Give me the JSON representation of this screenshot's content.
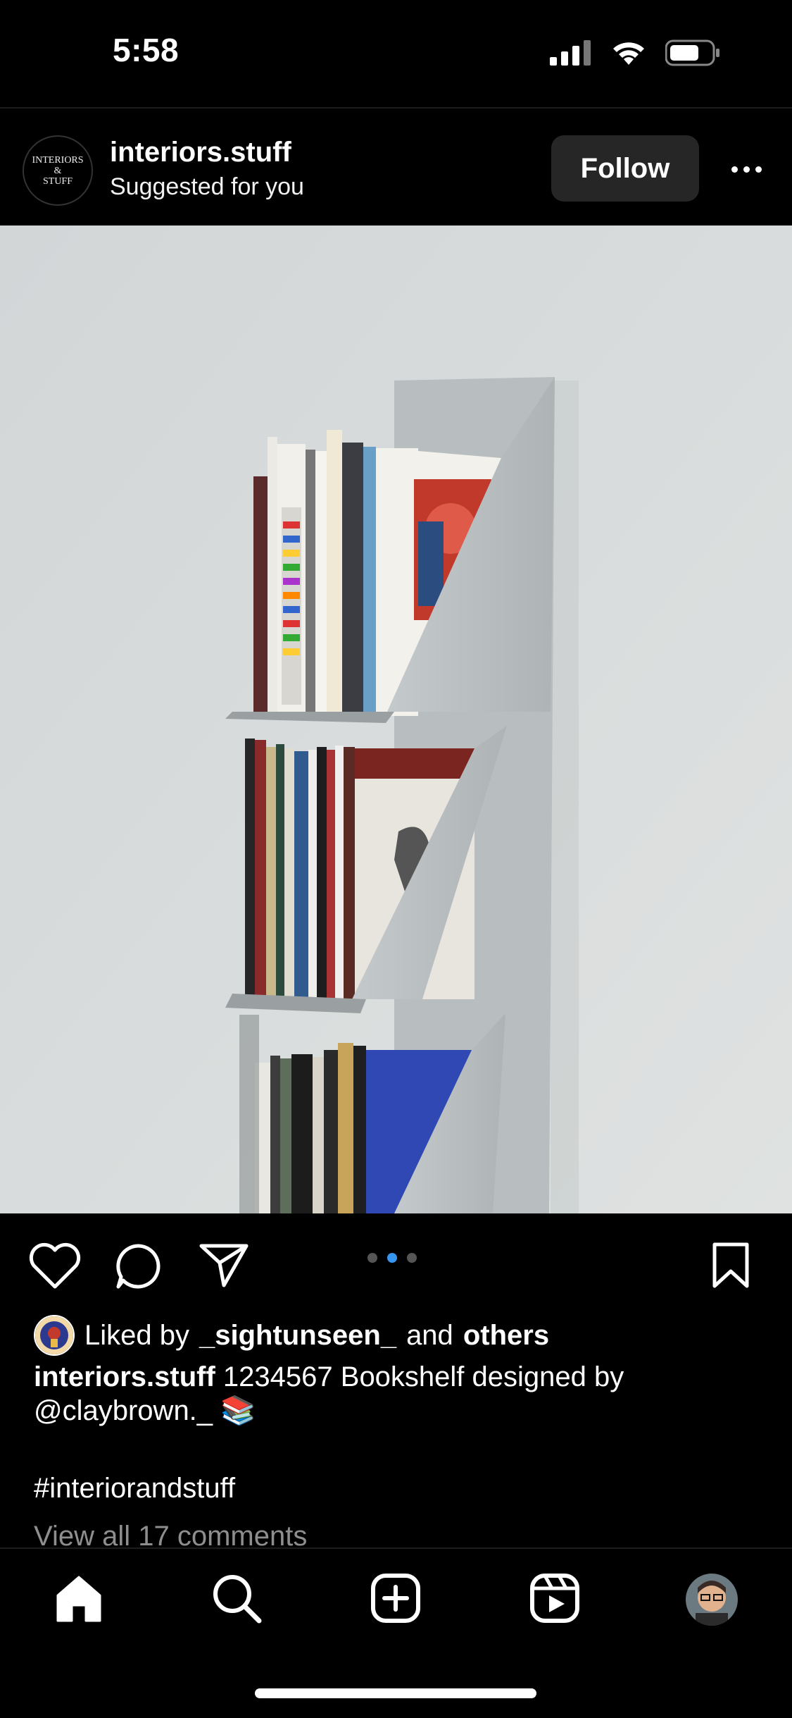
{
  "status_bar": {
    "time": "5:58"
  },
  "post": {
    "username": "interiors.stuff",
    "subtitle": "Suggested for you",
    "follow_label": "Follow",
    "avatar_text": {
      "line1": "INTERIORS",
      "line2": "&",
      "line3": "STUFF"
    },
    "carousel": {
      "count": 3,
      "active_index": 1
    },
    "liked_by_prefix": "Liked by",
    "liked_by_user": "_sightunseen_",
    "liked_by_and": "and",
    "liked_by_others": "others",
    "caption_user": "interiors.stuff",
    "caption_text": "1234567 Bookshelf designed by @claybrown._ 📚",
    "hashtag": "#interiorandstuff",
    "comments_link": "View all 17 comments"
  },
  "tab_bar": {
    "items": [
      "home-icon",
      "search-icon",
      "create-icon",
      "reels-icon",
      "profile-avatar"
    ]
  },
  "colors": {
    "background": "#000000",
    "accent": "#3797f0",
    "button": "#262626",
    "muted": "#8e8e8e"
  }
}
